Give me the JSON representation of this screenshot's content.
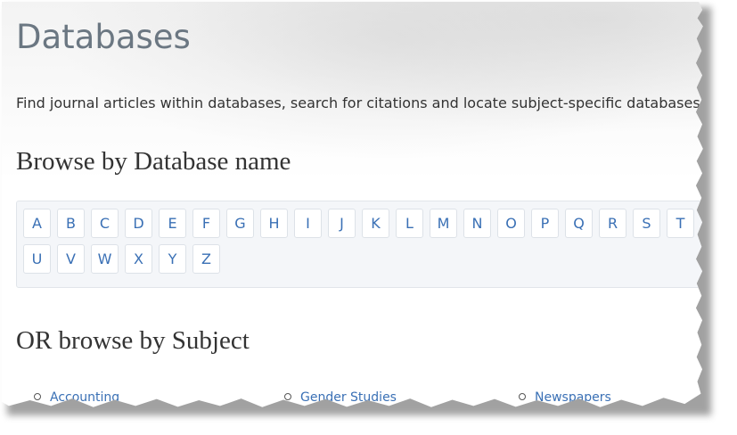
{
  "page": {
    "title": "Databases",
    "intro": "Find journal articles within databases, search for citations and locate subject-specific databases"
  },
  "browse_name": {
    "heading": "Browse by Database name",
    "row1": [
      "A",
      "B",
      "C",
      "D",
      "E",
      "F",
      "G",
      "H",
      "I",
      "J",
      "K",
      "L",
      "M",
      "N",
      "O",
      "P",
      "Q",
      "R",
      "S",
      "T"
    ],
    "row2": [
      "U",
      "V",
      "W",
      "X",
      "Y",
      "Z"
    ]
  },
  "browse_subject": {
    "heading": "OR browse by Subject",
    "items": [
      "Accounting",
      "Gender Studies",
      "Newspapers"
    ]
  },
  "colors": {
    "title": "#6b7782",
    "link": "#3a70b5",
    "alpha_bg": "#f4f6f9"
  }
}
